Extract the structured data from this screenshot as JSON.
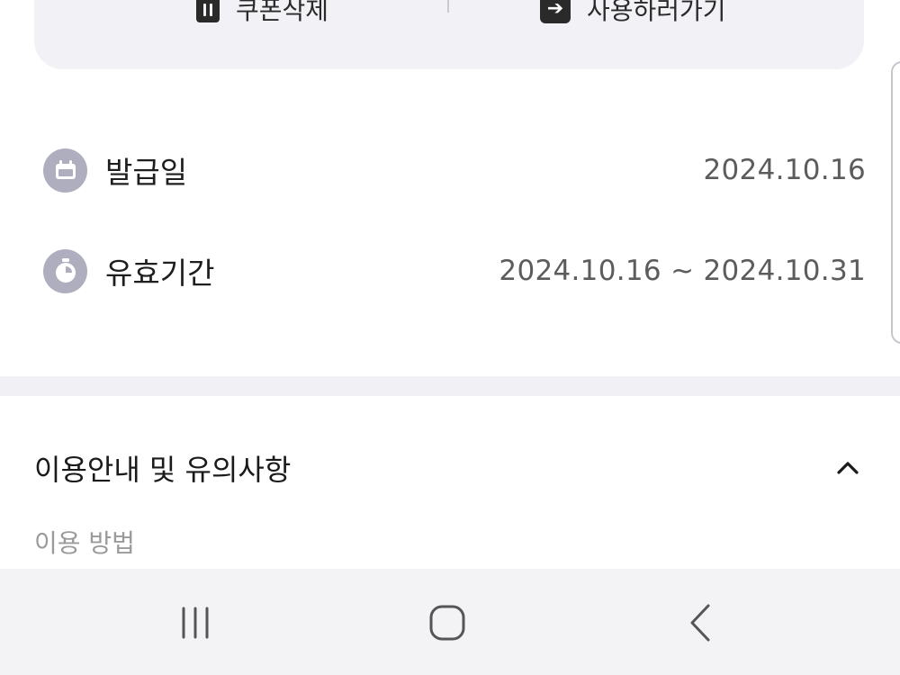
{
  "actions": {
    "delete_label": "쿠폰삭제",
    "use_label": "사용하러가기"
  },
  "info": {
    "issue_label": "발급일",
    "issue_value": "2024.10.16",
    "validity_label": "유효기간",
    "validity_value": "2024.10.16 ~ 2024.10.31"
  },
  "guide": {
    "title": "이용안내 및 유의사항",
    "sub_heading": "이용 방법",
    "expanded": true
  },
  "icons": {
    "delete": "trash-icon",
    "use": "arrow-right-box-icon",
    "issue": "calendar-icon",
    "validity": "stopwatch-icon",
    "accordion": "chevron-up-icon",
    "nav_recents": "recents-icon",
    "nav_home": "home-icon",
    "nav_back": "back-icon"
  },
  "colors": {
    "card_bg": "#f1f1f6",
    "icon_circle": "#aeaebf",
    "value_text": "#5c5c5c",
    "nav_bar_bg": "#f3f3f6"
  }
}
